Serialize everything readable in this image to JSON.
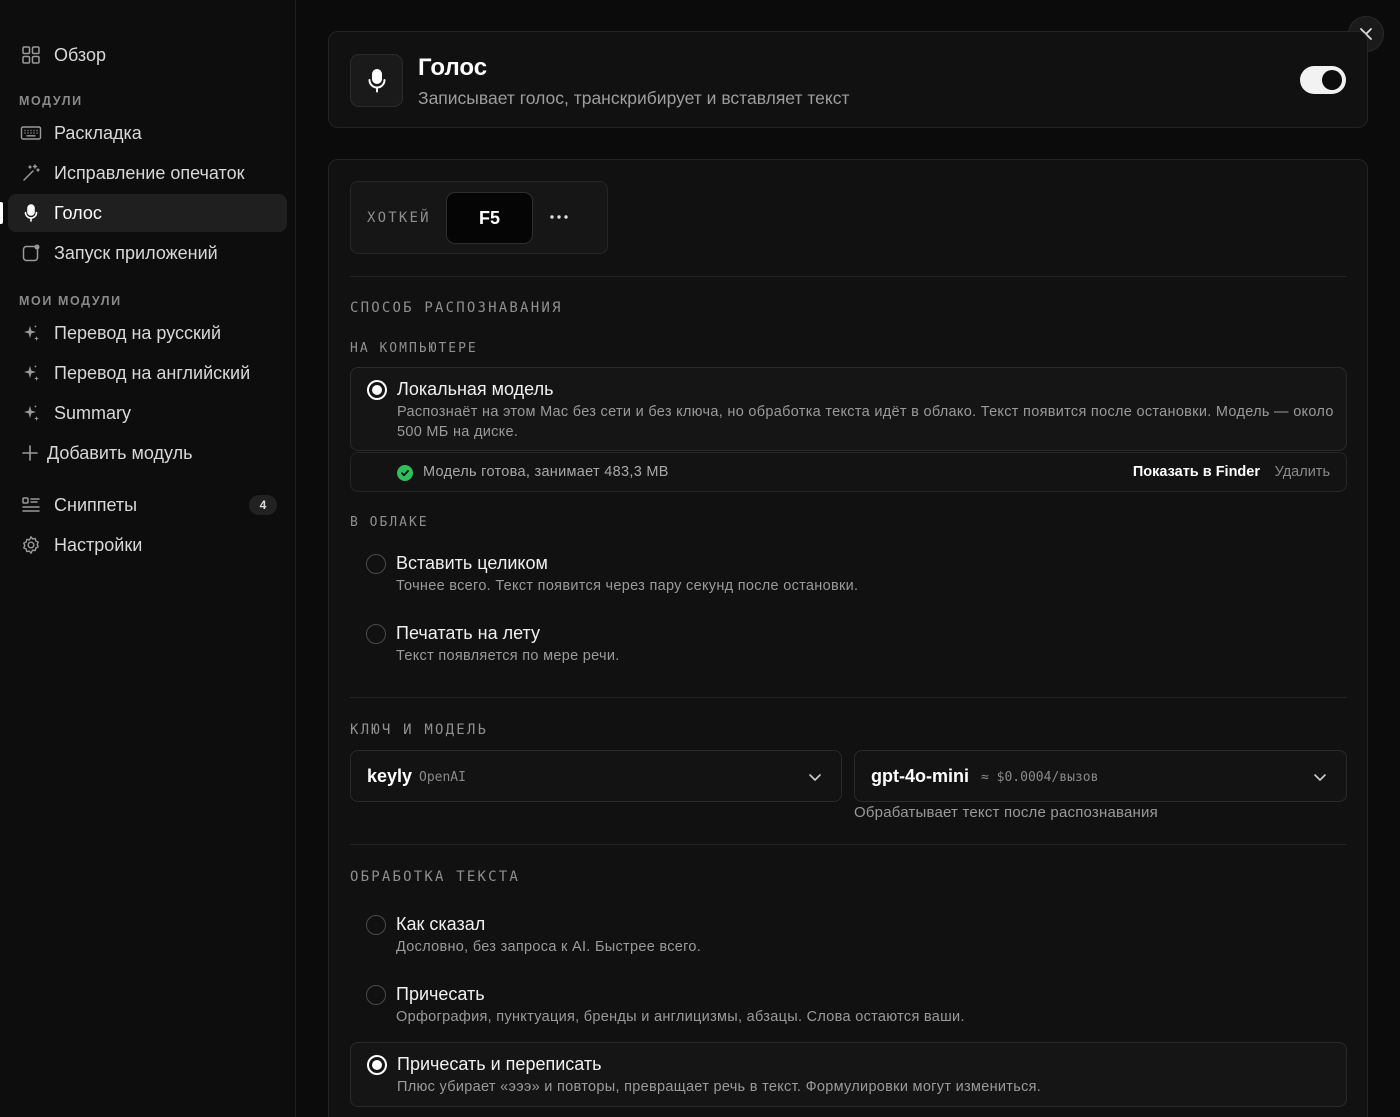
{
  "sidebar": {
    "overview": "Обзор",
    "modules_section": "МОДУЛИ",
    "modules": [
      "Раскладка",
      "Исправление опечаток",
      "Голос",
      "Запуск приложений"
    ],
    "my_modules_section": "МОИ МОДУЛИ",
    "my_modules": [
      "Перевод на русский",
      "Перевод на английский",
      "Summary"
    ],
    "add_module": "Добавить модуль",
    "snippets": "Сниппеты",
    "snippets_count": "4",
    "settings": "Настройки"
  },
  "header": {
    "title": "Голос",
    "subtitle": "Записывает голос, транскрибирует и вставляет текст",
    "enabled": true
  },
  "hotkey": {
    "label": "ХОТКЕЙ",
    "key": "F5",
    "more": "···"
  },
  "recognition": {
    "section": "СПОСОБ РАСПОЗНАВАНИЯ",
    "local_label": "НА КОМПЬЮТЕРЕ",
    "local_option": {
      "title": "Локальная модель",
      "desc": "Распознаёт на этом Mac без сети и без ключа, но обработка текста идёт в облако. Текст появится после остановки. Модель — около 500 МБ на диске.",
      "selected": true
    },
    "status": {
      "text": "Модель готова, занимает 483,3 MB",
      "show_in_finder": "Показать в Finder",
      "delete": "Удалить"
    },
    "cloud_label": "В ОБЛАКЕ",
    "cloud_options": [
      {
        "title": "Вставить целиком",
        "desc": "Точнее всего. Текст появится через пару секунд после остановки.",
        "selected": false
      },
      {
        "title": "Печатать на лету",
        "desc": "Текст появляется по мере речи.",
        "selected": false
      }
    ]
  },
  "key_model": {
    "section": "КЛЮЧ И МОДЕЛЬ",
    "key_name": "keyly",
    "key_provider": "OpenAI",
    "model_name": "gpt-4o-mini",
    "model_price": "≈ $0.0004/вызов",
    "model_hint": "Обрабатывает текст после распознавания"
  },
  "processing": {
    "section": "ОБРАБОТКА ТЕКСТА",
    "options": [
      {
        "title": "Как сказал",
        "desc": "Дословно, без запроса к AI. Быстрее всего.",
        "selected": false
      },
      {
        "title": "Причесать",
        "desc": "Орфография, пунктуация, бренды и англицизмы, абзацы. Слова остаются ваши.",
        "selected": false
      },
      {
        "title": "Причесать и переписать",
        "desc": "Плюс убирает «эээ» и повторы, превращает речь в текст. Формулировки могут измениться.",
        "selected": true
      }
    ]
  }
}
